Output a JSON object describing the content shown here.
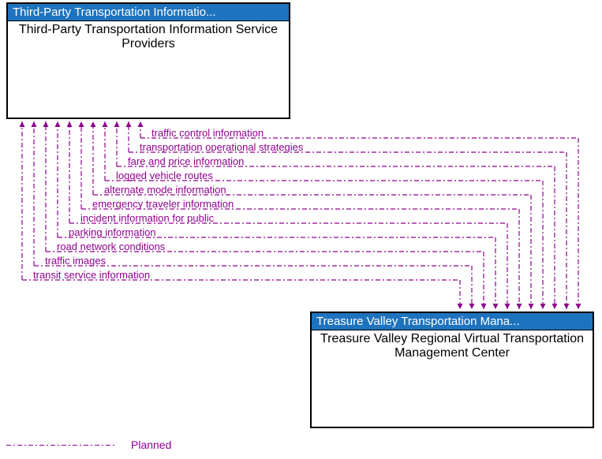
{
  "boxes": {
    "source": {
      "header": "Third-Party Transportation Informatio...",
      "title": "Third-Party Transportation Information Service Providers"
    },
    "target": {
      "header": "Treasure Valley Transportation Mana...",
      "title": "Treasure Valley Regional Virtual Transportation Management Center"
    }
  },
  "flows": [
    "traffic control information",
    "transportation operational strategies",
    "fare and price information",
    "logged vehicle routes",
    "alternate mode information",
    "emergency traveler information",
    "incident information for public",
    "parking information",
    "road network conditions",
    "traffic images",
    "transit service information"
  ],
  "legend": {
    "planned": "Planned"
  },
  "colors": {
    "flow": "#8e008e",
    "header_bg": "#1e73be"
  }
}
